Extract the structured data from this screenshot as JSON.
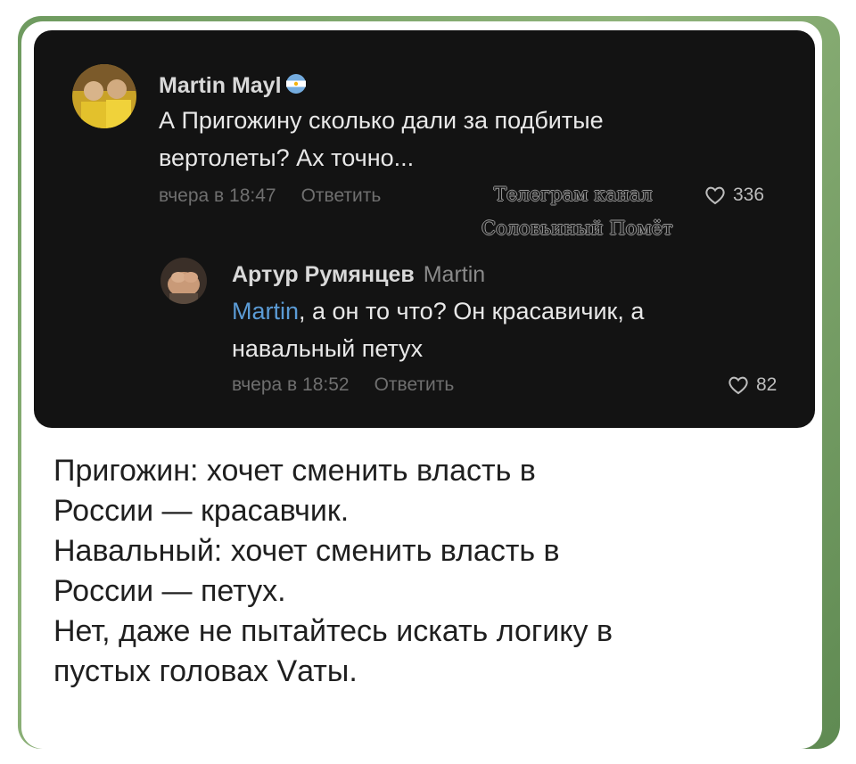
{
  "comments": [
    {
      "author": "Martin Mayl",
      "badge_icon": "argentina-flag-icon",
      "text_lines": [
        "А Пригожину сколько дали за подбитые",
        "вертолеты? Ах точно..."
      ],
      "time": "вчера в 18:47",
      "reply_label": "Ответить",
      "likes": "336"
    },
    {
      "author": "Артур Румянцев",
      "reply_to": "Martin",
      "mention": "Martin",
      "text_first_rest": ", а он то что? Он красавичик, а",
      "text_second": "навальный петух",
      "time": "вчера в 18:52",
      "reply_label": "Ответить",
      "likes": "82"
    }
  ],
  "watermark": {
    "line1": "Телеграм канал",
    "line2": "Соловьиный Помёт"
  },
  "caption_lines": [
    "Пригожин: хочет сменить власть в",
    "России — красавчик.",
    "Навальный: хочет сменить власть в",
    "России — петух.",
    "Нет, даже не пытайтесь искать логику в",
    "пустых головах Vаты."
  ],
  "colors": {
    "frame": "#6e9a5f",
    "dark_background": "#131313",
    "mention": "#5b9bd5"
  }
}
